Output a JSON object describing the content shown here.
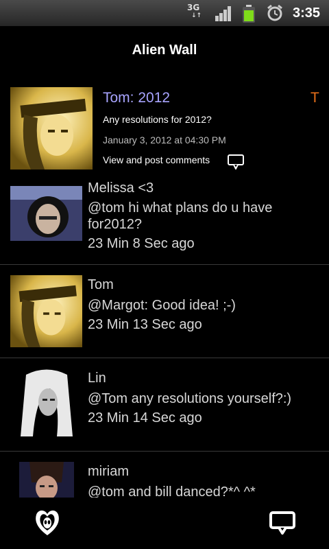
{
  "status_bar": {
    "network": "3G",
    "time": "3:35"
  },
  "header": {
    "title": "Alien Wall"
  },
  "post": {
    "title": "Tom: 2012",
    "flag": "T",
    "text": "Any resolutions for 2012?",
    "date": "January 3, 2012 at 04:30 PM",
    "link": "View and post comments"
  },
  "comments": [
    {
      "name": "Melissa <3",
      "text_line1": "@tom hi what plans do u have",
      "text_line2": "for2012?",
      "time": "23 Min 8 Sec ago"
    },
    {
      "name": "Tom",
      "text_line1": "@Margot: Good idea! ;-)",
      "time": "23 Min 13 Sec ago"
    },
    {
      "name": "Lin",
      "text_line1": "@Tom any resolutions yourself?:)",
      "time": "23 Min 14 Sec ago"
    },
    {
      "name": "miriam",
      "text_line1": "@tom and bill danced?*^  ^*"
    }
  ],
  "colors": {
    "post_title": "#a8a4ff",
    "flag": "#e8701a",
    "battery": "#7fdc1a"
  }
}
